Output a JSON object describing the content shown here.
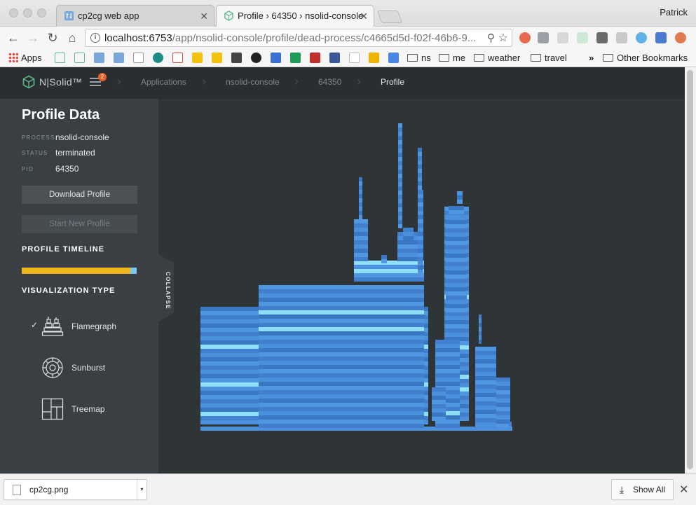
{
  "browser": {
    "tabs": [
      {
        "title": "cp2cg web app",
        "icon": "cp2cg-tab-icon",
        "active": false
      },
      {
        "title": "Profile › 64350 › nsolid-console",
        "icon": "nsolid-tab-icon",
        "active": true
      }
    ],
    "profile_name": "Patrick",
    "url_host": "localhost:6753",
    "url_path": "/app/nsolid-console/profile/dead-process/c4665d5d-f02f-46b6-9...",
    "bookmarks": {
      "apps": "Apps",
      "ns": "ns",
      "me": "me",
      "weather": "weather",
      "travel": "travel",
      "overflow": "»",
      "other": "Other Bookmarks"
    }
  },
  "app": {
    "logo": "N|Solid™",
    "notification_count": "2",
    "breadcrumbs": [
      "Applications",
      "nsolid-console",
      "64350",
      "Profile"
    ]
  },
  "sidebar": {
    "title": "Profile Data",
    "process_label": "PROCESS",
    "process_value": "nsolid-console",
    "status_label": "STATUS",
    "status_value": "terminated",
    "pid_label": "PID",
    "pid_value": "64350",
    "download_button": "Download Profile",
    "new_profile_button": "Start New Profile",
    "timeline_heading": "PROFILE TIMELINE",
    "viz_heading": "VISUALIZATION TYPE",
    "viz_options": [
      {
        "label": "Flamegraph",
        "selected": true
      },
      {
        "label": "Sunburst",
        "selected": false
      },
      {
        "label": "Treemap",
        "selected": false
      }
    ],
    "collapse_label": "COLLAPSE"
  },
  "colors": {
    "flame_base": "#4a90dc",
    "flame_dark": "#3a78c4",
    "flame_highlight": "#8ee0f8",
    "timeline": "#f1b51c"
  },
  "downloads": {
    "file_name": "cp2cg.png",
    "show_all": "Show All"
  }
}
